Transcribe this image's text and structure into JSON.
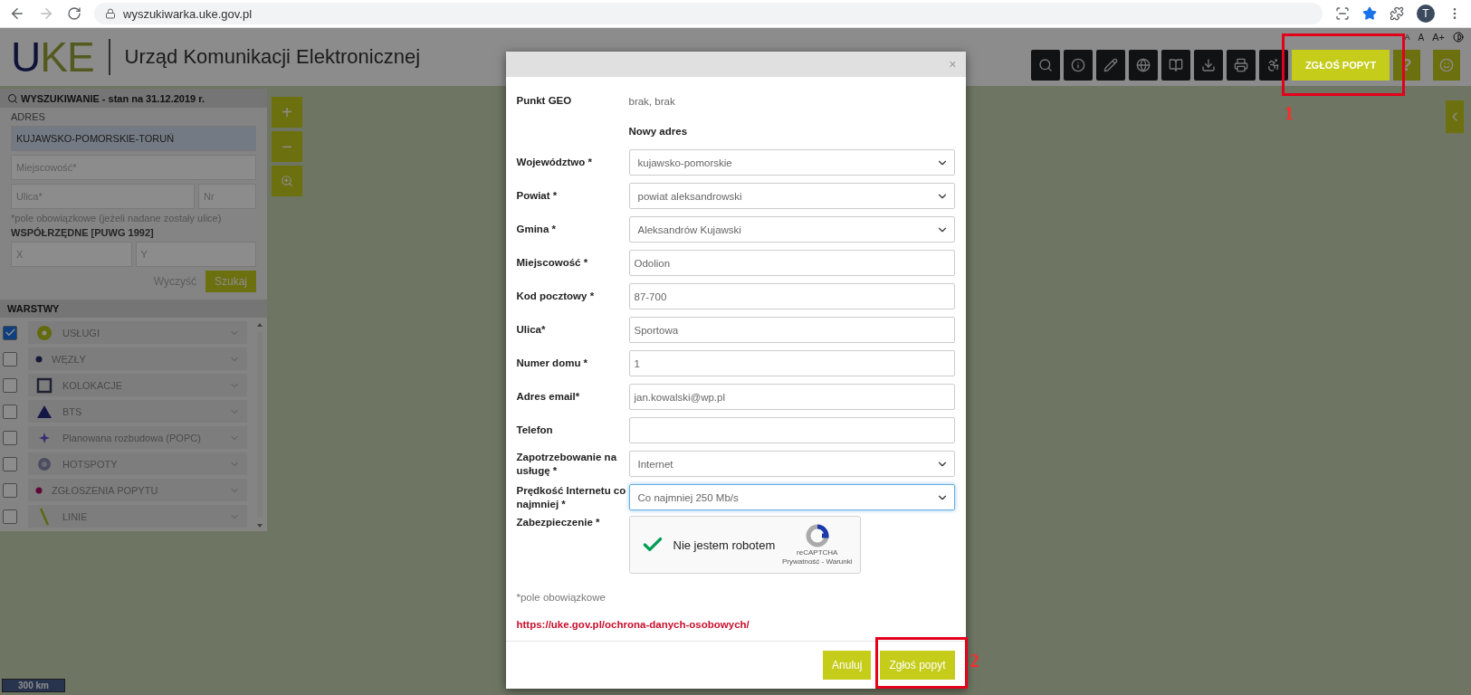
{
  "browser": {
    "url": "wyszukiwarka.uke.gov.pl",
    "avatar": "T"
  },
  "header": {
    "logo": "UKE",
    "title": "Urząd Komunikacji Elektronicznej",
    "font_controls": [
      "A",
      "A",
      "A+"
    ],
    "demand_button": {
      "label": "ZGŁOŚ POPYT",
      "annotation": "1"
    },
    "help_button": "?"
  },
  "search_panel": {
    "title": "WYSZUKIWANIE - stan na 31.12.2019 r.",
    "address_label": "ADRES",
    "address_value": "KUJAWSKO-POMORSKIE-TORUŃ",
    "town_placeholder": "Miejscowość*",
    "street_placeholder": "Ulica*",
    "number_placeholder": "Nr",
    "note": "*pole obowiązkowe (jeżeli nadane zostały ulice)",
    "coords_label": "WSPÓŁRZĘDNE [PUWG 1992]",
    "x_placeholder": "X",
    "y_placeholder": "Y",
    "clear": "Wyczyść",
    "search": "Szukaj"
  },
  "layers": {
    "title": "WARSTWY",
    "items": [
      {
        "label": "USŁUGI",
        "checked": true,
        "kind": "ring"
      },
      {
        "label": "WĘZŁY",
        "checked": false,
        "kind": "dot"
      },
      {
        "label": "KOLOKACJE",
        "checked": false,
        "kind": "square"
      },
      {
        "label": "BTS",
        "checked": false,
        "kind": "triangle"
      },
      {
        "label": "Planowana rozbudowa (POPC)",
        "checked": false,
        "kind": "star"
      },
      {
        "label": "HOTSPOTY",
        "checked": false,
        "kind": "disc"
      },
      {
        "label": "ZGŁOSZENIA POPYTU",
        "checked": false,
        "kind": "pin"
      },
      {
        "label": "LINIE",
        "checked": false,
        "kind": "line"
      }
    ]
  },
  "map": {
    "zoom_in": "+",
    "zoom_out": "−",
    "scale": "300 km"
  },
  "modal": {
    "geo_label": "Punkt GEO",
    "geo_value": "brak, brak",
    "subheading": "Nowy adres",
    "close": "×",
    "fields": [
      {
        "label": "Województwo *",
        "kind": "select",
        "value": "kujawsko-pomorskie",
        "focused": false
      },
      {
        "label": "Powiat *",
        "kind": "select",
        "value": "powiat aleksandrowski",
        "focused": false
      },
      {
        "label": "Gmina *",
        "kind": "select",
        "value": "Aleksandrów Kujawski",
        "focused": false
      },
      {
        "label": "Miejscowość *",
        "kind": "input",
        "value": "Odolion",
        "focused": false
      },
      {
        "label": "Kod pocztowy *",
        "kind": "input",
        "value": "87-700",
        "focused": false
      },
      {
        "label": "Ulica*",
        "kind": "input",
        "value": "Sportowa",
        "focused": false
      },
      {
        "label": "Numer domu *",
        "kind": "input",
        "value": "1",
        "focused": false
      },
      {
        "label": "Adres email*",
        "kind": "input",
        "value": "jan.kowalski@wp.pl",
        "focused": false
      },
      {
        "label": "Telefon",
        "kind": "input",
        "focused": false
      },
      {
        "label": "Zapotrzebowanie na usługę *",
        "kind": "select",
        "value": "Internet",
        "focused": false
      },
      {
        "label": "Prędkość Internetu co najmniej *",
        "kind": "select",
        "value": "Co najmniej 250 Mb/s",
        "focused": true
      }
    ],
    "captcha": {
      "label": "Zabezpieczenie *",
      "text": "Nie jestem robotem",
      "checked": true,
      "brand": "reCAPTCHA",
      "links": "Prywatność - Warunki"
    },
    "required_note": "*pole obowiązkowe",
    "link": "https://uke.gov.pl/ochrona-danych-osobowych/",
    "cancel": "Anuluj",
    "submit": {
      "label": "Zgłoś popyt",
      "annotation": "2"
    }
  }
}
